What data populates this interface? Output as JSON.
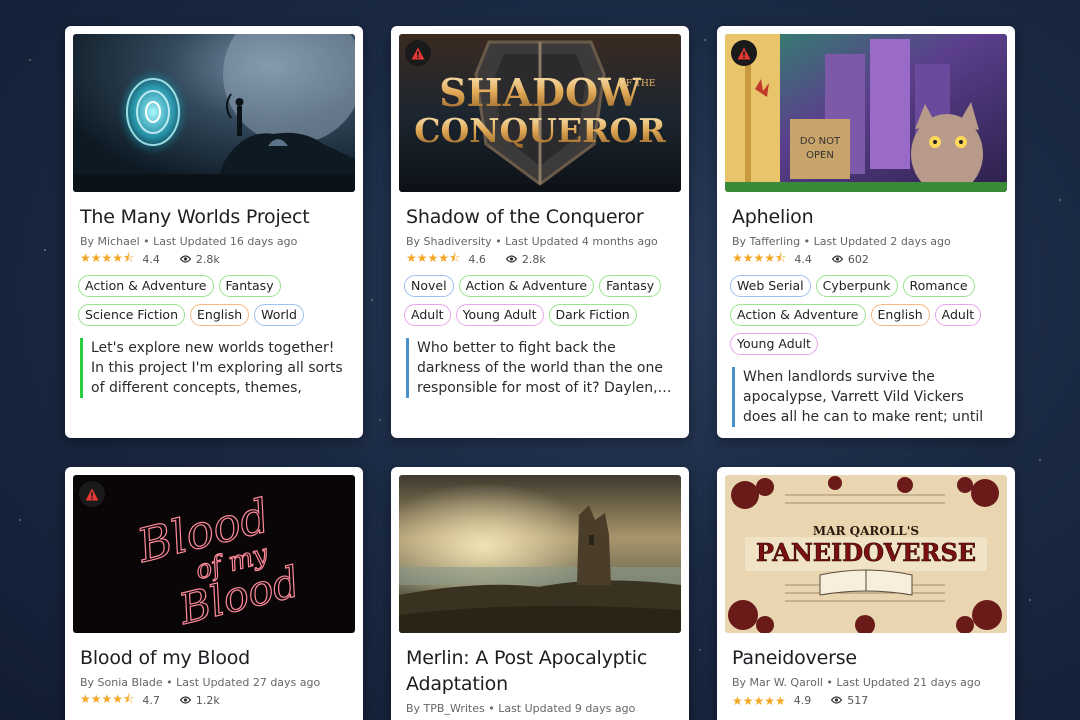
{
  "colors": {
    "star": "#f5a623",
    "warning_red": "#e53935",
    "tag_green": "#9be38f",
    "tag_orange": "#f7b985",
    "tag_blue": "#9fc2ee",
    "tag_pink": "#e8a7ec",
    "desc_green": "#2ecc40",
    "desc_blue": "#4a90c8"
  },
  "cards": [
    {
      "title": "The Many Worlds Project",
      "meta": "By Michael • Last Updated 16 days ago",
      "stars": "★★★★⯪",
      "rating": "4.4",
      "views": "2.8k",
      "tags": [
        "Action & Adventure",
        "Fantasy",
        "Science Fiction",
        "English",
        "World"
      ],
      "description": "Let's explore new worlds together! In this project I'm exploring all sorts of different concepts, themes, genres…"
    },
    {
      "title": "Shadow of the Conqueror",
      "meta": "By Shadiversity • Last Updated 4 months ago",
      "stars": "★★★★⯪",
      "rating": "4.6",
      "views": "2.8k",
      "cover_text_1": "SHADOW",
      "cover_text_2": "OF THE",
      "cover_text_3": "CONQUEROR",
      "tags": [
        "Novel",
        "Action & Adventure",
        "Fantasy",
        "Adult",
        "Young Adult",
        "Dark Fiction"
      ],
      "description": "Who better to fight back the darkness of the world than the one responsible for most of it? Daylen,…"
    },
    {
      "title": "Aphelion",
      "meta": "By Tafferling • Last Updated 2 days ago",
      "stars": "★★★★⯪",
      "rating": "4.4",
      "views": "602",
      "cover_text_1": "DO NOT",
      "cover_text_2": "OPEN",
      "tags": [
        "Web Serial",
        "Cyberpunk",
        "Romance",
        "Action & Adventure",
        "English",
        "Adult",
        "Young Adult"
      ],
      "description": "When landlords survive the apocalypse, Varrett Vild Vickers does all he can to make rent; until a…"
    },
    {
      "title": "Blood of my Blood",
      "meta": "By Sonia Blade • Last Updated 27 days ago",
      "stars": "★★★★⯪",
      "rating": "4.7",
      "views": "1.2k",
      "cover_text_1": "Blood",
      "cover_text_2": "of my",
      "cover_text_3": "Blood"
    },
    {
      "title": "Merlin: A Post Apocalyptic Adaptation",
      "meta": "By TPB_Writes • Last Updated 9 days ago"
    },
    {
      "title": "Paneidoverse",
      "meta": "By Mar W. Qaroll • Last Updated 21 days ago",
      "stars": "★★★★★",
      "rating": "4.9",
      "views": "517",
      "cover_text_1": "MAR QAROLL'S",
      "cover_text_2": "PANEIDOVERSE"
    }
  ]
}
